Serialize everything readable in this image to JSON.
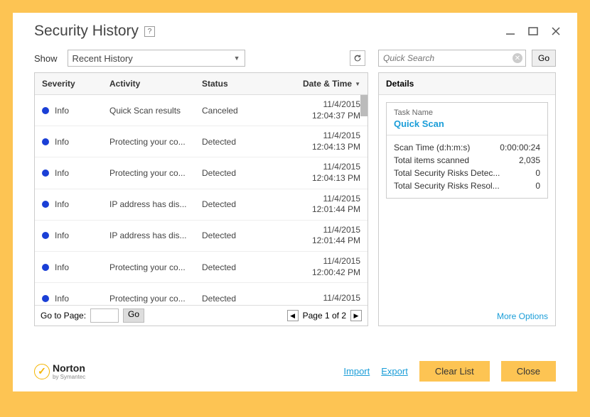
{
  "title": "Security History",
  "show_label": "Show",
  "dropdown_value": "Recent History",
  "search_placeholder": "Quick Search",
  "go_label": "Go",
  "columns": {
    "severity": "Severity",
    "activity": "Activity",
    "status": "Status",
    "datetime": "Date & Time"
  },
  "rows": [
    {
      "severity": "Info",
      "activity": "Quick Scan results",
      "status": "Canceled",
      "date": "11/4/2015",
      "time": "12:04:37 PM"
    },
    {
      "severity": "Info",
      "activity": "Protecting your co...",
      "status": "Detected",
      "date": "11/4/2015",
      "time": "12:04:13 PM"
    },
    {
      "severity": "Info",
      "activity": "Protecting your co...",
      "status": "Detected",
      "date": "11/4/2015",
      "time": "12:04:13 PM"
    },
    {
      "severity": "Info",
      "activity": "IP address has dis...",
      "status": "Detected",
      "date": "11/4/2015",
      "time": "12:01:44 PM"
    },
    {
      "severity": "Info",
      "activity": "IP address has dis...",
      "status": "Detected",
      "date": "11/4/2015",
      "time": "12:01:44 PM"
    },
    {
      "severity": "Info",
      "activity": "Protecting your co...",
      "status": "Detected",
      "date": "11/4/2015",
      "time": "12:00:42 PM"
    },
    {
      "severity": "Info",
      "activity": "Protecting your co...",
      "status": "Detected",
      "date": "11/4/2015",
      "time": ""
    }
  ],
  "pager": {
    "goto_label": "Go to Page:",
    "go_label": "Go",
    "page_text": "Page 1 of 2"
  },
  "details": {
    "header": "Details",
    "task_label": "Task Name",
    "task_name": "Quick Scan",
    "stats": [
      {
        "label": "Scan Time (d:h:m:s)",
        "value": "0:00:00:24"
      },
      {
        "label": "Total items scanned",
        "value": "2,035"
      },
      {
        "label": "Total Security Risks Detec...",
        "value": "0"
      },
      {
        "label": "Total Security Risks Resol...",
        "value": "0"
      }
    ],
    "more_options": "More Options"
  },
  "footer": {
    "brand": "Norton",
    "brand_sub": "by Symantec",
    "import": "Import",
    "export": "Export",
    "clear_list": "Clear List",
    "close": "Close"
  }
}
